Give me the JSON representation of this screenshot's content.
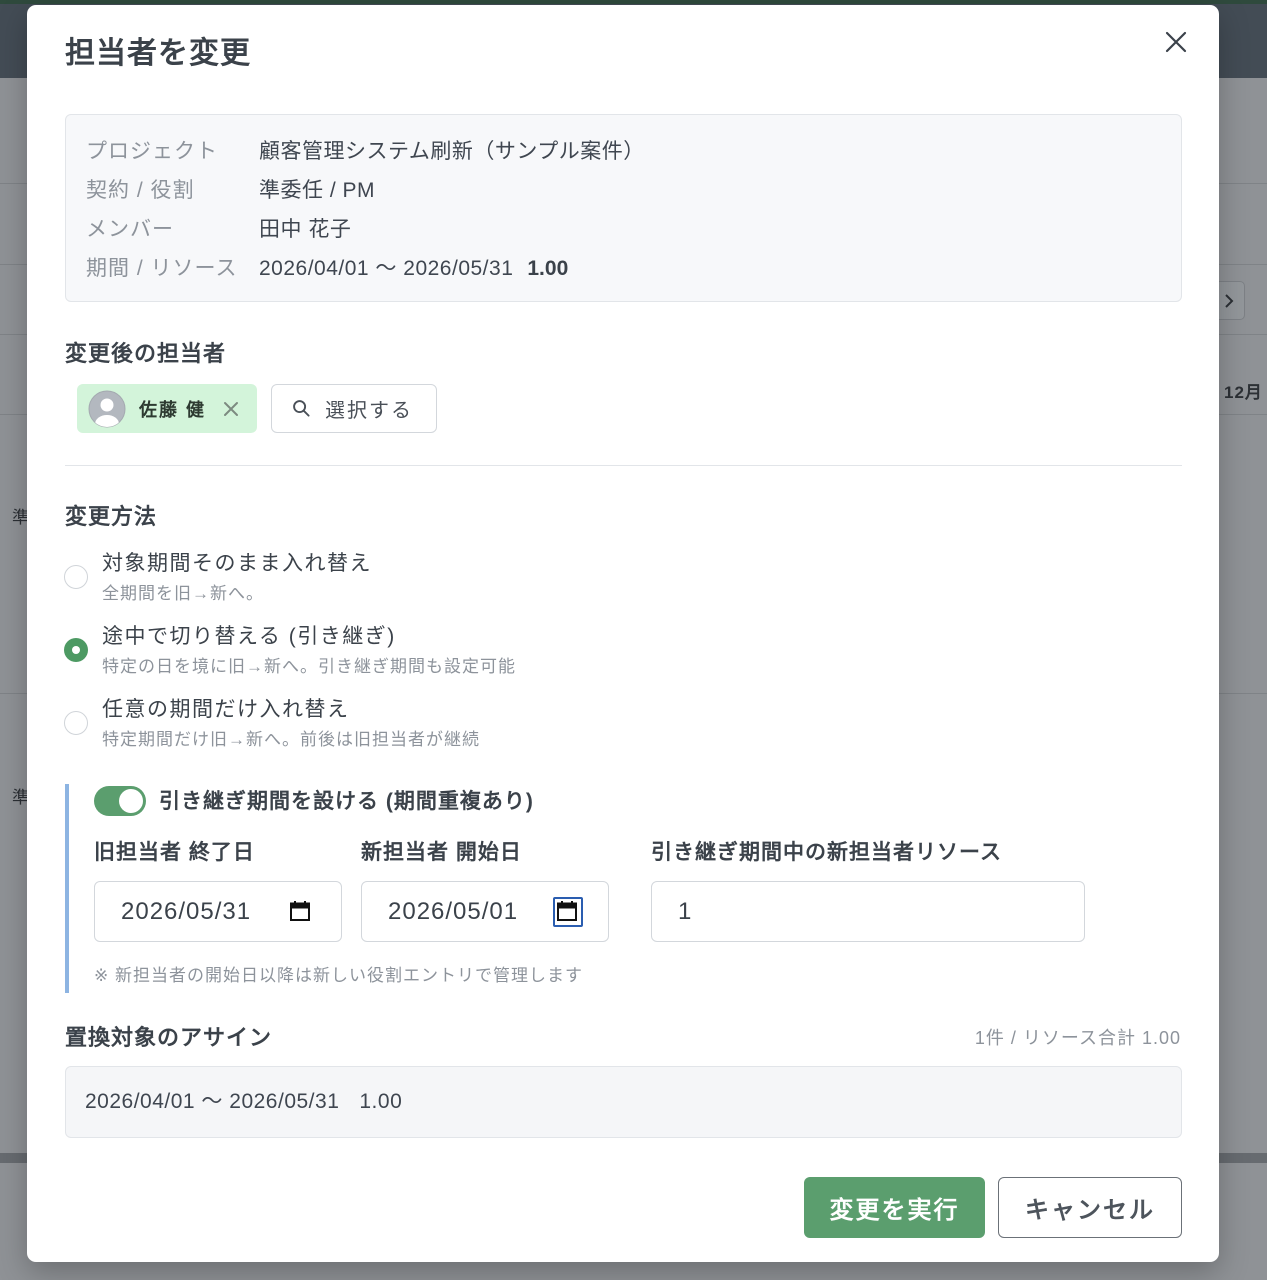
{
  "background": {
    "month_label": "12月",
    "row_labels": [
      "準",
      "準"
    ]
  },
  "dialog": {
    "title": "担当者を変更",
    "info": {
      "rows": [
        {
          "label": "プロジェクト",
          "value": "顧客管理システム刷新（サンプル案件）"
        },
        {
          "label": "契約 / 役割",
          "value": "準委任 / PM"
        },
        {
          "label": "メンバー",
          "value": "田中 花子"
        },
        {
          "label": "期間 / リソース",
          "value": "2026/04/01 〜 2026/05/31",
          "resource": "1.00"
        }
      ]
    },
    "new_assignee": {
      "heading": "変更後の担当者",
      "chip_name": "佐藤 健",
      "select_label": "選択する"
    },
    "method": {
      "heading": "変更方法",
      "selected_index": 1,
      "options": [
        {
          "label": "対象期間そのまま入れ替え",
          "description": "全期間を旧→新へ。"
        },
        {
          "label": "途中で切り替える (引き継ぎ)",
          "description": "特定の日を境に旧→新へ。引き継ぎ期間も設定可能"
        },
        {
          "label": "任意の期間だけ入れ替え",
          "description": "特定期間だけ旧→新へ。前後は旧担当者が継続"
        }
      ]
    },
    "handover": {
      "enabled": true,
      "toggle_label": "引き継ぎ期間を設ける (期間重複あり)",
      "old_end_label": "旧担当者 終了日",
      "old_end_value": "2026/05/31",
      "new_start_label": "新担当者 開始日",
      "new_start_value": "2026/05/01",
      "resource_label": "引き継ぎ期間中の新担当者リソース",
      "resource_value": "1",
      "note": "※ 新担当者の開始日以降は新しい役割エントリで管理します"
    },
    "targets": {
      "heading": "置換対象のアサイン",
      "summary": "1件 / リソース合計 1.00",
      "rows": [
        {
          "period": "2026/04/01 〜 2026/05/31",
          "resource": "1.00"
        }
      ]
    },
    "footer": {
      "submit_label": "変更を実行",
      "cancel_label": "キャンセル"
    }
  },
  "icons": {
    "close": "close-icon",
    "avatar": "avatar-icon",
    "remove": "remove-icon",
    "search": "search-icon",
    "calendar": "calendar-icon",
    "next": "chevron-right-icon"
  },
  "colors": {
    "accent": "#5b9e6e",
    "focus": "#2a5db0",
    "handover_border": "#8db4e2",
    "chip_bg": "#d3f4da"
  }
}
